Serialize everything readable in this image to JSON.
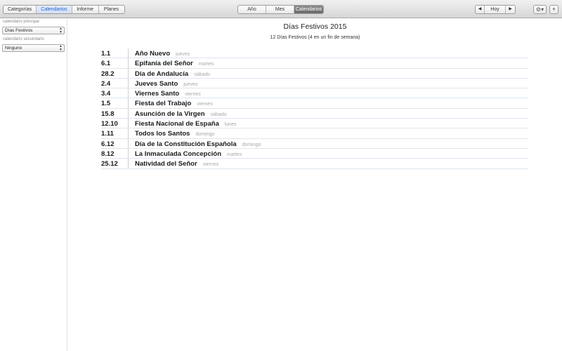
{
  "toolbar": {
    "left_tabs": [
      "Categorías",
      "Calendarios",
      "Informe",
      "Planes"
    ],
    "left_selected": "Calendarios",
    "view_tabs": [
      "Año",
      "Mes",
      "Calendarios"
    ],
    "view_selected": "Calendarios",
    "nav": {
      "prev": "◀",
      "today": "Hoy",
      "next": "▶"
    },
    "gear": "⚙▾",
    "add": "+"
  },
  "sidebar": {
    "primary_label": "calendario principal",
    "primary_value": "Días Festivos",
    "secondary_label": "calendario secundario",
    "secondary_value": "Ninguno"
  },
  "main": {
    "title": "Días Festivos 2015",
    "subtitle": "12 Días Festivos (4 en un fin de semana)",
    "holidays": [
      {
        "date": "1.1",
        "name": "Año Nuevo",
        "day": "jueves"
      },
      {
        "date": "6.1",
        "name": "Epifanía del Señor",
        "day": "martes"
      },
      {
        "date": "28.2",
        "name": "Día de Andalucía",
        "day": "sábado"
      },
      {
        "date": "2.4",
        "name": "Jueves Santo",
        "day": "jueves"
      },
      {
        "date": "3.4",
        "name": "Viernes Santo",
        "day": "viernes"
      },
      {
        "date": "1.5",
        "name": "Fiesta del Trabajo",
        "day": "viernes"
      },
      {
        "date": "15.8",
        "name": "Asunción de la Virgen",
        "day": "sábado"
      },
      {
        "date": "12.10",
        "name": "Fiesta Nacional de España",
        "day": "lunes"
      },
      {
        "date": "1.11",
        "name": "Todos los Santos",
        "day": "domingo"
      },
      {
        "date": "6.12",
        "name": "Día de la Constitución Española",
        "day": "domingo"
      },
      {
        "date": "8.12",
        "name": "La Inmaculada Concepción",
        "day": "martes"
      },
      {
        "date": "25.12",
        "name": "Natividad del Señor",
        "day": "viernes"
      }
    ]
  },
  "colors": {
    "accent": "#1e5fd0",
    "selected_segment": "#7a7a7a",
    "row_divider": "#dde6ee",
    "weekday_text": "#a8a8a8"
  }
}
